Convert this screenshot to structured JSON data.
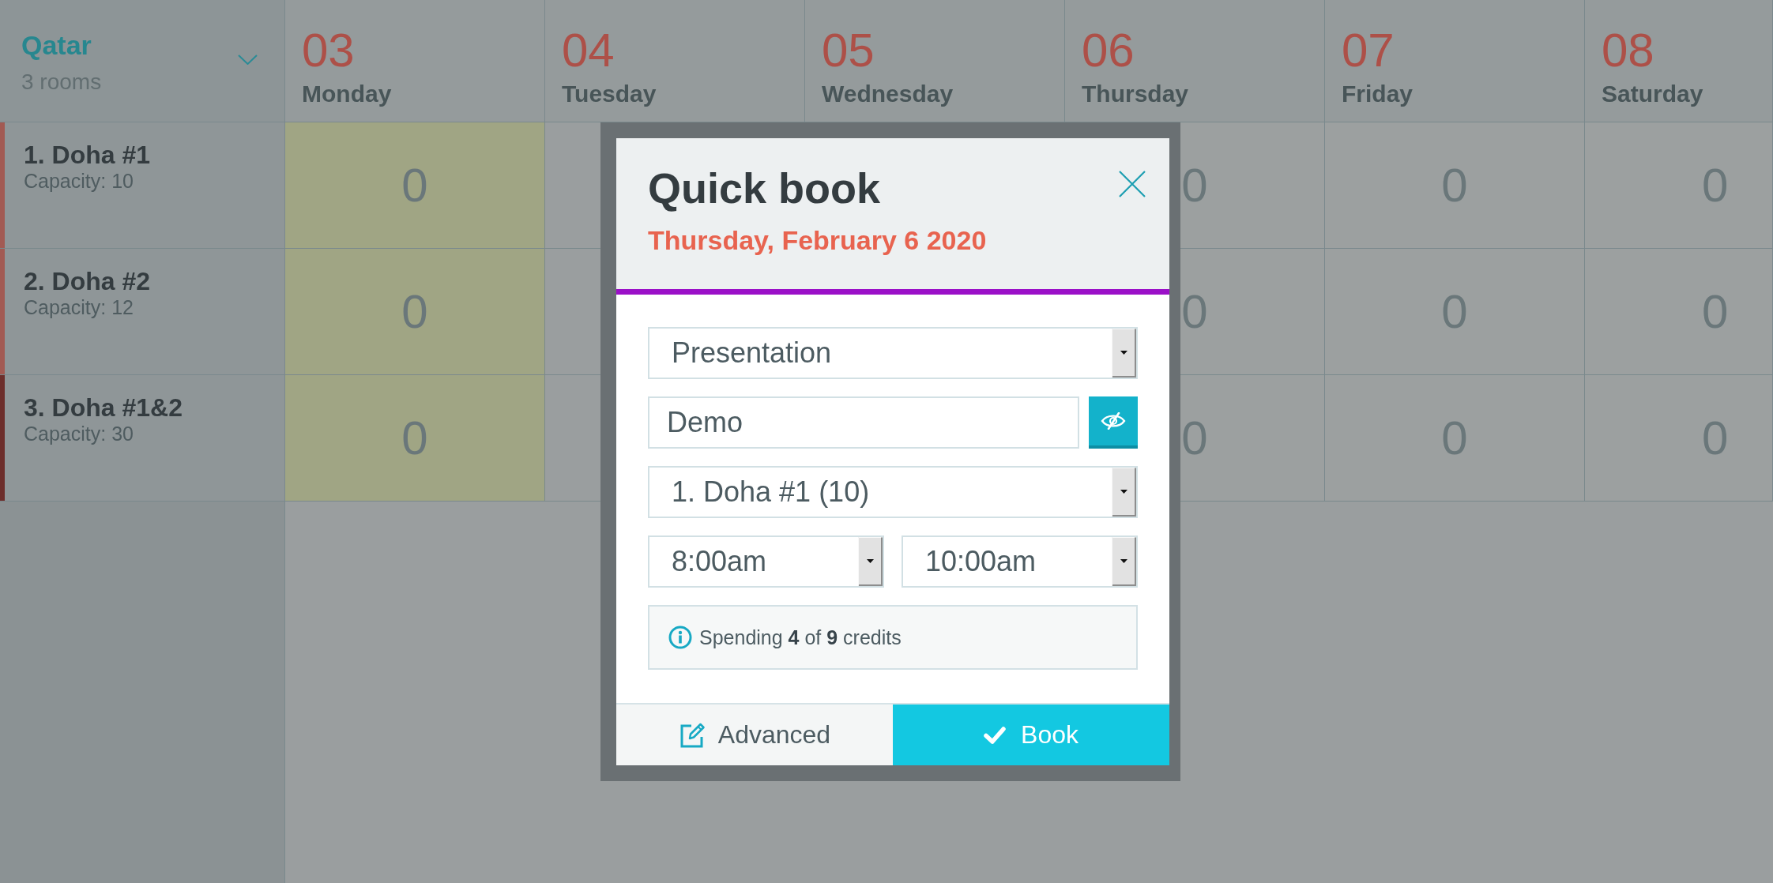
{
  "calendar": {
    "location": {
      "name": "Qatar",
      "subtitle": "3 rooms"
    },
    "days": [
      {
        "number": "03",
        "name": "Monday"
      },
      {
        "number": "04",
        "name": "Tuesday"
      },
      {
        "number": "05",
        "name": "Wednesday"
      },
      {
        "number": "06",
        "name": "Thursday"
      },
      {
        "number": "07",
        "name": "Friday"
      },
      {
        "number": "08",
        "name": "Saturday"
      }
    ],
    "rooms": [
      {
        "name": "1. Doha #1",
        "capacity": "Capacity: 10",
        "color": "#a25a53",
        "cells": [
          {
            "value": "0",
            "highlighted": true
          },
          null,
          null,
          {
            "value": "0",
            "highlighted": false
          },
          {
            "value": "0",
            "highlighted": false
          },
          {
            "value": "0",
            "highlighted": false
          }
        ]
      },
      {
        "name": "2. Doha #2",
        "capacity": "Capacity: 12",
        "color": "#a25a53",
        "cells": [
          {
            "value": "0",
            "highlighted": true
          },
          null,
          null,
          {
            "value": "0",
            "highlighted": false
          },
          {
            "value": "0",
            "highlighted": false
          },
          {
            "value": "0",
            "highlighted": false
          }
        ]
      },
      {
        "name": "3. Doha #1&2",
        "capacity": "Capacity: 30",
        "color": "#6d2e2b",
        "cells": [
          {
            "value": "0",
            "highlighted": true
          },
          null,
          null,
          {
            "value": "0",
            "highlighted": false
          },
          {
            "value": "0",
            "highlighted": false
          },
          {
            "value": "0",
            "highlighted": false
          }
        ]
      }
    ]
  },
  "dialog": {
    "title": "Quick book",
    "date": "Thursday, February 6 2020",
    "fields": [
      {
        "kind": "select",
        "value": "Presentation"
      },
      {
        "kind": "text",
        "value": "Demo",
        "private": true
      },
      {
        "kind": "select",
        "value": "1. Doha #1 (10)"
      }
    ],
    "time_range": {
      "start": "8:00am",
      "end": "10:00am"
    },
    "info": "Spending **4** of **9** credits",
    "buttons": [
      {
        "kind": "secondary",
        "label": "Advanced"
      },
      {
        "kind": "primary",
        "label": "Book"
      }
    ]
  }
}
